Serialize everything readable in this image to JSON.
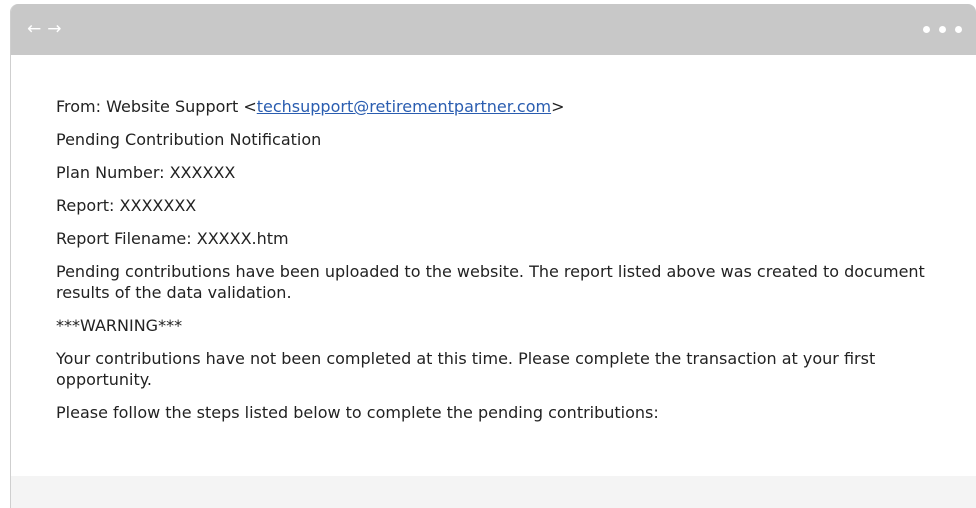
{
  "nav": {
    "back_glyph": "←",
    "forward_glyph": "→"
  },
  "email": {
    "from_prefix": "From: Website Support <",
    "from_address": "techsupport@retirementpartner.com",
    "from_suffix": ">",
    "subject": "Pending Contribution Notification",
    "plan_number": "Plan Number: XXXXXX",
    "report": "Report: XXXXXXX",
    "report_filename": "Report Filename: XXXXX.htm",
    "body_1": "Pending contributions have been uploaded to the website. The report listed above was created to document results of the data validation.",
    "warning": "***WARNING***",
    "body_2": "Your contributions have not been completed at this time. Please complete the transaction at your first opportunity.",
    "body_3": "Please follow the steps listed below to complete the pending contributions:"
  },
  "colors": {
    "titlebar": "#c8c8c8",
    "link": "#2a5db0",
    "text": "#222222"
  }
}
